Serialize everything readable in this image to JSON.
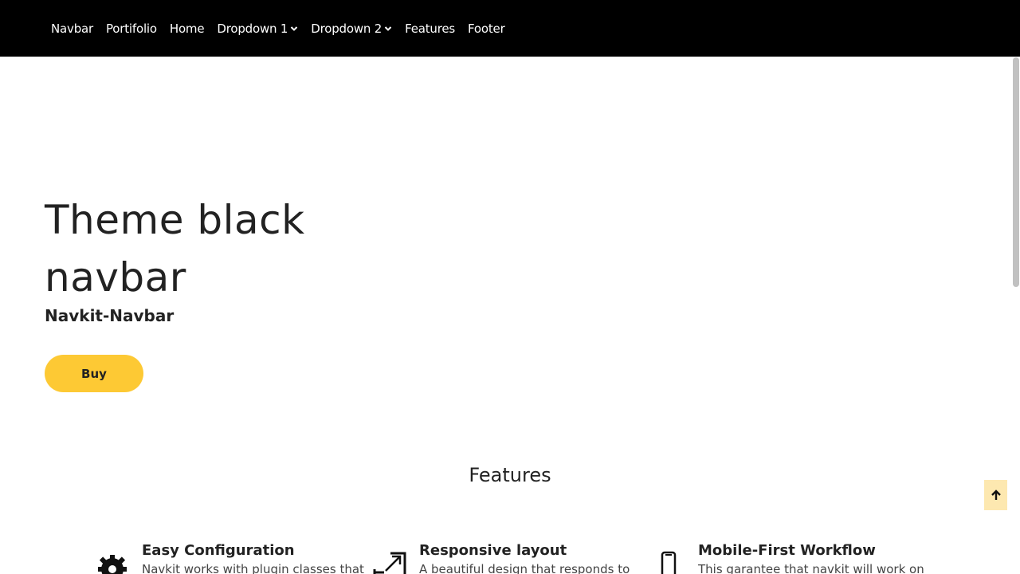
{
  "navbar": {
    "items": [
      {
        "label": "Navbar"
      },
      {
        "label": "Portifolio"
      },
      {
        "label": "Home"
      },
      {
        "label": "Dropdown 1",
        "has_caret": true
      },
      {
        "label": "Dropdown 2",
        "has_caret": true
      },
      {
        "label": "Features"
      },
      {
        "label": "Footer"
      }
    ]
  },
  "hero": {
    "title": "Theme black navbar",
    "subtitle": "Navkit-Navbar",
    "buy_label": "Buy"
  },
  "features": {
    "heading": "Features",
    "items": [
      {
        "icon": "gear-icon",
        "title": "Easy Configuration",
        "desc": "Navkit works with plugin classes that"
      },
      {
        "icon": "expand-arrow-icon",
        "title": "Responsive layout",
        "desc": "A beautiful design that responds to"
      },
      {
        "icon": "mobile-phone-icon",
        "title": "Mobile-First Workflow",
        "desc": "This garantee that navkit will work on"
      }
    ]
  },
  "colors": {
    "navbar_bg": "#000000",
    "accent": "#fdc934",
    "back_to_top_bg": "#fde8b0"
  },
  "back_to_top": {
    "icon": "arrow-up-icon"
  }
}
